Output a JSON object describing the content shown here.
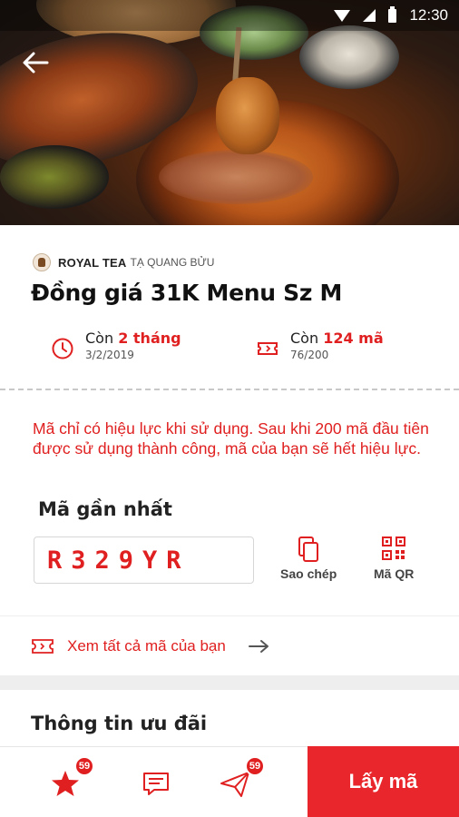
{
  "status_bar": {
    "time": "12:30"
  },
  "hero": {
    "image": "hotpot-food-photo"
  },
  "store": {
    "name": "ROYAL TEA",
    "branch": "TẠ QUANG BỬU"
  },
  "deal": {
    "title": "Đồng giá 31K Menu Sz M"
  },
  "stats": {
    "time_left": {
      "prefix": "Còn",
      "value": "2 tháng",
      "date": "3/2/2019",
      "icon": "clock-icon"
    },
    "codes_left": {
      "prefix": "Còn",
      "value": "124 mã",
      "count": "76/200",
      "icon": "ticket-icon"
    }
  },
  "notice": "Mã chỉ có hiệu lực khi sử dụng. Sau khi 200 mã đầu tiên được sử dụng thành công, mã của bạn sẽ hết hiệu lực.",
  "recent_code": {
    "title": "Mã gần nhất",
    "code": "R329YR",
    "copy_label": "Sao chép",
    "qr_label": "Mã QR"
  },
  "view_all": {
    "label": "Xem tất cả mã của bạn"
  },
  "offer_section": {
    "title": "Thông tin ưu đãi"
  },
  "bottom_bar": {
    "favorites_badge": "59",
    "messages_icon": "chat-icon",
    "share_badge": "59",
    "cta_label": "Lấy mã"
  },
  "colors": {
    "accent": "#e02020",
    "cta": "#e8262b"
  }
}
